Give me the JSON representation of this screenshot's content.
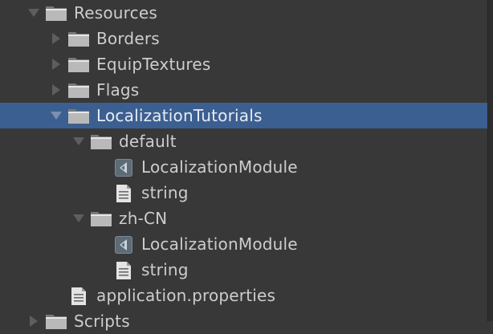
{
  "tree": {
    "resources": {
      "label": "Resources",
      "icon": "folder-icon",
      "expanded": true
    },
    "borders": {
      "label": "Borders",
      "icon": "folder-icon",
      "expanded": false
    },
    "equip_textures": {
      "label": "EquipTextures",
      "icon": "folder-icon",
      "expanded": false
    },
    "flags": {
      "label": "Flags",
      "icon": "folder-icon",
      "expanded": false
    },
    "localization_tutorials": {
      "label": "LocalizationTutorials",
      "icon": "folder-icon",
      "expanded": true,
      "selected": true
    },
    "default_folder": {
      "label": "default",
      "icon": "folder-icon",
      "expanded": true
    },
    "default_module": {
      "label": "LocalizationModule",
      "icon": "module-asset-icon"
    },
    "default_string": {
      "label": "string",
      "icon": "text-file-icon"
    },
    "zhcn_folder": {
      "label": "zh-CN",
      "icon": "folder-icon",
      "expanded": true
    },
    "zhcn_module": {
      "label": "LocalizationModule",
      "icon": "module-asset-icon"
    },
    "zhcn_string": {
      "label": "string",
      "icon": "text-file-icon"
    },
    "application_properties": {
      "label": "application.properties",
      "icon": "text-file-icon"
    },
    "scripts": {
      "label": "Scripts",
      "icon": "folder-icon",
      "expanded": false
    }
  },
  "colors": {
    "background": "#383838",
    "selection": "#3c5f91",
    "text": "#cdcdcd",
    "arrow": "#5c5c5c"
  }
}
